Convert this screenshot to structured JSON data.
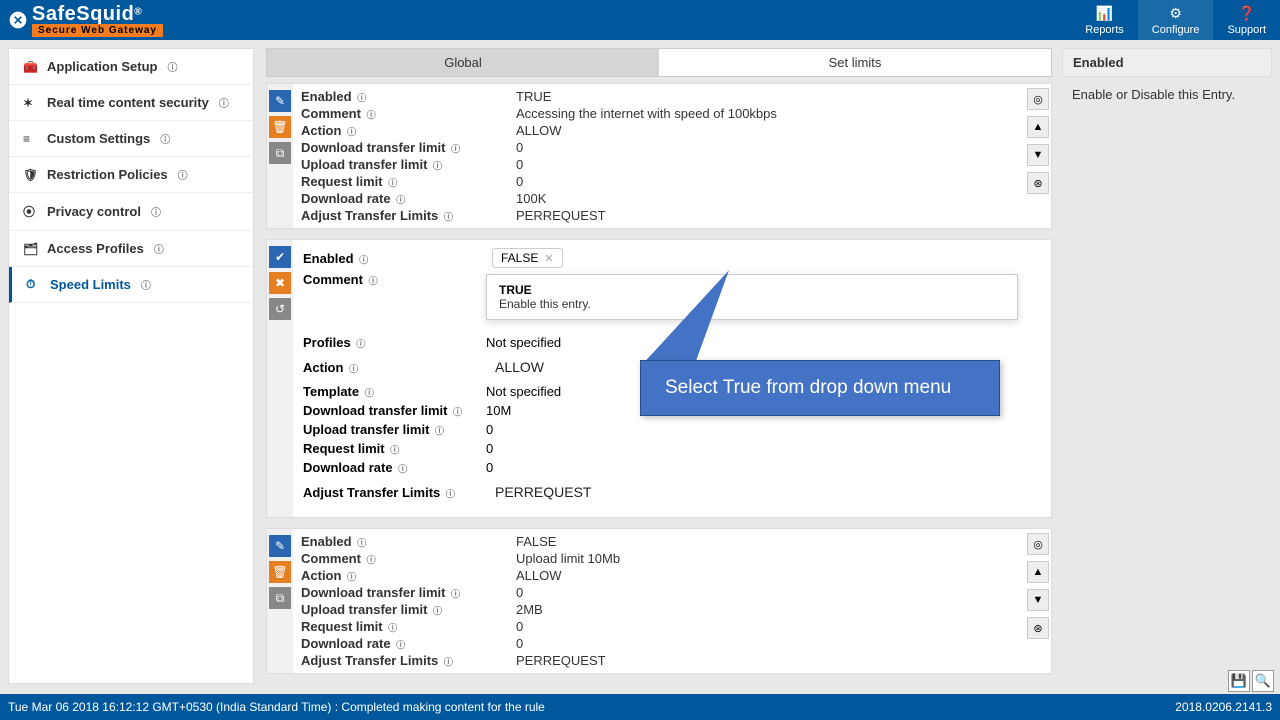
{
  "header": {
    "brand": "SafeSquid",
    "reg": "®",
    "tagline": "Secure Web Gateway",
    "nav": {
      "reports": "Reports",
      "configure": "Configure",
      "support": "Support"
    }
  },
  "sidebar": {
    "items": [
      {
        "label": "Application Setup"
      },
      {
        "label": "Real time content security"
      },
      {
        "label": "Custom Settings"
      },
      {
        "label": "Restriction Policies"
      },
      {
        "label": "Privacy control"
      },
      {
        "label": "Access Profiles"
      },
      {
        "label": "Speed Limits"
      }
    ]
  },
  "tabs": {
    "global": "Global",
    "setlimits": "Set limits"
  },
  "entries": [
    {
      "enabled": "TRUE",
      "comment": "Accessing the internet with speed of 100kbps",
      "action": "ALLOW",
      "download_transfer_limit": "0",
      "upload_transfer_limit": "0",
      "request_limit": "0",
      "download_rate": "100K",
      "adjust_transfer_limits": "PERREQUEST"
    },
    {
      "enabled_tag": "FALSE",
      "comment_placeholder": "",
      "profiles_placeholder": "Not specified",
      "action": "ALLOW",
      "template_placeholder": "Not specified",
      "download_transfer_limit": "10M",
      "upload_transfer_limit": "0",
      "request_limit": "0",
      "download_rate": "0",
      "adjust_transfer_limits": "PERREQUEST",
      "dropdown": {
        "title": "TRUE",
        "desc": "Enable this entry."
      }
    },
    {
      "enabled": "FALSE",
      "comment": "Upload limit 10Mb",
      "action": "ALLOW",
      "download_transfer_limit": "0",
      "upload_transfer_limit": "2MB",
      "request_limit": "0",
      "download_rate": "0",
      "adjust_transfer_limits": "PERREQUEST"
    }
  ],
  "labels": {
    "enabled": "Enabled",
    "comment": "Comment",
    "action": "Action",
    "download_transfer_limit": "Download transfer limit",
    "upload_transfer_limit": "Upload transfer limit",
    "request_limit": "Request limit",
    "download_rate": "Download rate",
    "adjust_transfer_limits": "Adjust Transfer Limits",
    "profiles": "Profiles",
    "template": "Template"
  },
  "infopanel": {
    "title": "Enabled",
    "body": "Enable or Disable this Entry."
  },
  "callout": "Select True from drop down menu",
  "footer": {
    "left": "Tue Mar 06 2018 16:12:12 GMT+0530 (India Standard Time) : Completed making content for the rule",
    "right": "2018.0206.2141.3"
  }
}
